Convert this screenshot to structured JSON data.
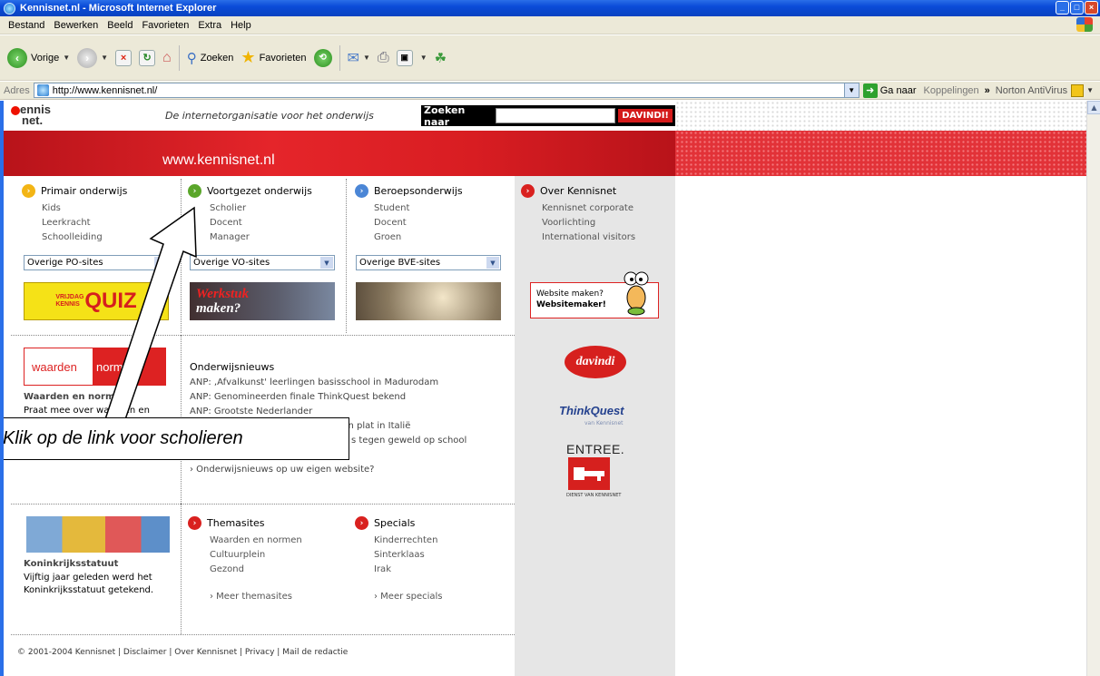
{
  "window": {
    "title": "Kennisnet.nl - Microsoft Internet Explorer",
    "min": "_",
    "max": "□",
    "close": "×"
  },
  "menu": [
    "Bestand",
    "Bewerken",
    "Beeld",
    "Favorieten",
    "Extra",
    "Help"
  ],
  "toolbar": {
    "back_label": "Vorige",
    "search_label": "Zoeken",
    "favorites_label": "Favorieten"
  },
  "address": {
    "label": "Adres",
    "url": "http://www.kennisnet.nl/",
    "go_label": "Ga naar",
    "links_label": "Koppelingen",
    "chevron": "»",
    "norton_label": "Norton AntiVirus"
  },
  "site": {
    "logo_top": "ennis",
    "logo_bottom": "net.",
    "tagline": "De internetorganisatie voor het onderwijs",
    "search_label": "Zoeken naar",
    "search_button": "DAVINDI!",
    "banner_url": "www.kennisnet.nl"
  },
  "columns": {
    "primair": {
      "title": "Primair onderwijs",
      "items": [
        "Kids",
        "Leerkracht",
        "Schoolleiding"
      ],
      "select": "Overige PO-sites"
    },
    "voortgezet": {
      "title": "Voortgezet onderwijs",
      "items": [
        "Scholier",
        "Docent",
        "Manager"
      ],
      "select": "Overige VO-sites"
    },
    "beroeps": {
      "title": "Beroepsonderwijs",
      "items": [
        "Student",
        "Docent",
        "Groen"
      ],
      "select": "Overige BVE-sites"
    },
    "over": {
      "title": "Over Kennisnet",
      "items": [
        "Kennisnet corporate",
        "Voorlichting",
        "International visitors"
      ]
    }
  },
  "promos": {
    "quiz_text": "QUIZ",
    "quiz_small": "VRIJDAG KENNIS",
    "werkstuk_line1": "Werkstuk",
    "werkstuk_line2": "maken?",
    "waarden_left": "waarden",
    "waarden_right": "normen",
    "waarden_title": "Waarden en normen",
    "waarden_desc": "Praat mee over waarden en",
    "websitemaker_line1": "Website maken?",
    "websitemaker_line2": "Websitemaker!",
    "davindi": "davindi",
    "thinkquest": "ThinkQuest",
    "thinkquest_sub": "van Kennisnet",
    "entree": "ENTREE.",
    "entree_sub": "DIENST VAN KENNISNET"
  },
  "news": {
    "title": "Onderwijsnieuws",
    "items": [
      "ANP: ,Afvalkunst' leerlingen basisschool in Madurodam",
      "ANP: Genomineerden finale ThinkQuest bekend",
      "ANP: Grootste Nederlander",
      "Novum: Lerarenstaking legt scholen plat in Italië",
      "s tegen geweld op school"
    ],
    "more": "› Onderwijsnieuws op uw eigen website?"
  },
  "bottom": {
    "kr_title": "Koninkrijksstatuut",
    "kr_line1": "Vijftig jaar geleden werd het",
    "kr_line2": "Koninkrijksstatuut getekend.",
    "thema_title": "Themasites",
    "thema_items": [
      "Waarden en normen",
      "Cultuurplein",
      "Gezond"
    ],
    "thema_more": "› Meer themasites",
    "specials_title": "Specials",
    "specials_items": [
      "Kinderrechten",
      "Sinterklaas",
      "Irak"
    ],
    "specials_more": "› Meer specials"
  },
  "footer": "© 2001-2004 Kennisnet | Disclaimer | Over Kennisnet | Privacy | Mail de redactie",
  "annotation": "Klik op de link voor scholieren"
}
